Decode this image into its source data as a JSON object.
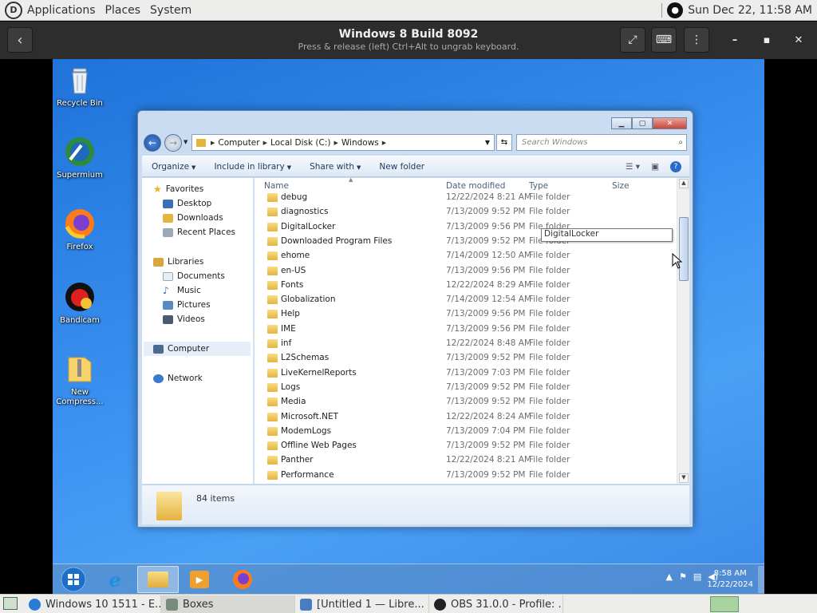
{
  "host_topbar": {
    "menus": [
      "Applications",
      "Places",
      "System"
    ],
    "clock": "Sun Dec 22, 11:58 AM"
  },
  "boxes_header": {
    "title": "Windows 8 Build 8092",
    "subtitle": "Press & release (left) Ctrl+Alt to ungrab keyboard."
  },
  "desktop_icons": [
    {
      "label": "Recycle Bin"
    },
    {
      "label": "Supermium"
    },
    {
      "label": "Firefox"
    },
    {
      "label": "Bandicam"
    },
    {
      "label": "New Compress..."
    }
  ],
  "explorer": {
    "breadcrumb": [
      "Computer",
      "Local Disk (C:)",
      "Windows"
    ],
    "search_placeholder": "Search Windows",
    "toolbar": {
      "organize": "Organize",
      "include_in_library": "Include in library",
      "share_with": "Share with",
      "new_folder": "New folder"
    },
    "nav": {
      "favorites": "Favorites",
      "desktop": "Desktop",
      "downloads": "Downloads",
      "recent_places": "Recent Places",
      "libraries": "Libraries",
      "documents": "Documents",
      "music": "Music",
      "pictures": "Pictures",
      "videos": "Videos",
      "computer": "Computer",
      "network": "Network"
    },
    "columns": {
      "name": "Name",
      "date": "Date modified",
      "type": "Type",
      "size": "Size"
    },
    "rows": [
      {
        "name": "debug",
        "date": "12/22/2024 8:21 AM",
        "type": "File folder"
      },
      {
        "name": "diagnostics",
        "date": "7/13/2009 9:52 PM",
        "type": "File folder"
      },
      {
        "name": "DigitalLocker",
        "date": "7/13/2009 9:56 PM",
        "type": "File folder"
      },
      {
        "name": "Downloaded Program Files",
        "date": "7/13/2009 9:52 PM",
        "type": "File folder"
      },
      {
        "name": "ehome",
        "date": "7/14/2009 12:50 AM",
        "type": "File folder"
      },
      {
        "name": "en-US",
        "date": "7/13/2009 9:56 PM",
        "type": "File folder"
      },
      {
        "name": "Fonts",
        "date": "12/22/2024 8:29 AM",
        "type": "File folder"
      },
      {
        "name": "Globalization",
        "date": "7/14/2009 12:54 AM",
        "type": "File folder"
      },
      {
        "name": "Help",
        "date": "7/13/2009 9:56 PM",
        "type": "File folder"
      },
      {
        "name": "IME",
        "date": "7/13/2009 9:56 PM",
        "type": "File folder"
      },
      {
        "name": "inf",
        "date": "12/22/2024 8:48 AM",
        "type": "File folder"
      },
      {
        "name": "L2Schemas",
        "date": "7/13/2009 9:52 PM",
        "type": "File folder"
      },
      {
        "name": "LiveKernelReports",
        "date": "7/13/2009 7:03 PM",
        "type": "File folder"
      },
      {
        "name": "Logs",
        "date": "7/13/2009 9:52 PM",
        "type": "File folder"
      },
      {
        "name": "Media",
        "date": "7/13/2009 9:52 PM",
        "type": "File folder"
      },
      {
        "name": "Microsoft.NET",
        "date": "12/22/2024 8:24 AM",
        "type": "File folder"
      },
      {
        "name": "ModemLogs",
        "date": "7/13/2009 7:04 PM",
        "type": "File folder"
      },
      {
        "name": "Offline Web Pages",
        "date": "7/13/2009 9:52 PM",
        "type": "File folder"
      },
      {
        "name": "Panther",
        "date": "12/22/2024 8:21 AM",
        "type": "File folder"
      },
      {
        "name": "Performance",
        "date": "7/13/2009 9:52 PM",
        "type": "File folder"
      }
    ],
    "tooltip": "DigitalLocker",
    "item_count": "84 items"
  },
  "vm_taskbar": {
    "time": "8:58 AM",
    "date": "12/22/2024"
  },
  "host_taskbar": [
    {
      "label": "Windows 10 1511 - E...",
      "color": "#2a7bd6"
    },
    {
      "label": "Boxes",
      "color": "#7a8a7a"
    },
    {
      "label": "[Untitled 1 — Libre...",
      "color": "#4a7cc1"
    },
    {
      "label": "OBS 31.0.0 - Profile: ...",
      "color": "#222222"
    }
  ]
}
